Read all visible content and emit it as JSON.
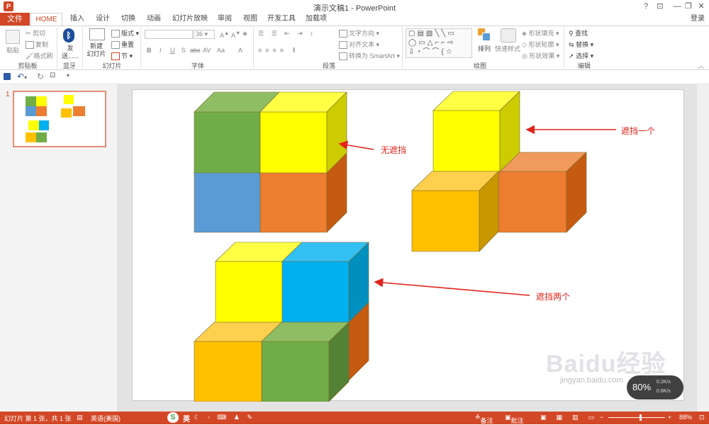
{
  "window": {
    "title": "演示文稿1 - PowerPoint",
    "controls": [
      "?",
      "⊡",
      "—",
      "❐",
      "✕"
    ]
  },
  "tabs": {
    "file": "文件",
    "items": [
      "HOME",
      "插入",
      "设计",
      "切换",
      "动画",
      "幻灯片放映",
      "审阅",
      "视图",
      "开发工具",
      "加载项"
    ],
    "login": "登录"
  },
  "ribbon": {
    "clipboard": {
      "paste": "粘贴",
      "cut": "剪切",
      "copy": "复制",
      "format_painter": "格式刷",
      "label": "剪贴板"
    },
    "bluetooth": {
      "send": "发送......",
      "label": "蓝牙"
    },
    "slides": {
      "new_slide": "新建\n幻灯片",
      "layout": "版式",
      "reset": "重置",
      "section": "节",
      "label": "幻灯片"
    },
    "font": {
      "font_size": "36",
      "label": "字体",
      "buttons": [
        "B",
        "I",
        "U",
        "S",
        "abc",
        "AV",
        "Aa",
        "A"
      ]
    },
    "paragraph": {
      "text_direction": "文字方向",
      "align_text": "对齐文本",
      "convert_smartart": "转换为 SmartArt",
      "label": "段落"
    },
    "drawing": {
      "arrange": "排列",
      "quick_styles": "快速样式",
      "shape_fill": "形状填充",
      "shape_outline": "形状轮廓",
      "shape_effects": "形状效果",
      "label": "绘图"
    },
    "editing": {
      "find": "查找",
      "replace": "替换",
      "select": "选择",
      "label": "编辑"
    }
  },
  "thumbnail": {
    "number": "1"
  },
  "slide": {
    "annotations": [
      "无遮挡",
      "遮挡一个",
      "遮挡两个"
    ]
  },
  "status": {
    "slide_info": "幻灯片 第 1 张，共 1 张",
    "language": "英语(美国)",
    "ime": "英",
    "notes": "备注",
    "comments": "批注",
    "zoom": "88%"
  },
  "overlay": {
    "watermark": "Baidu经验",
    "watermark_url": "jingyan.baidu.com",
    "meter_value": "80%",
    "meter_up": "0.2K/s",
    "meter_down": "0.6K/s"
  },
  "colors": {
    "accent": "#d24726",
    "green": "#70ad47",
    "yellow": "#ffff00",
    "blue": "#5b9bd5",
    "orange": "#ed7d31",
    "gold": "#ffc000",
    "cyan": "#00b0f0",
    "annotation": "#e2231a"
  }
}
